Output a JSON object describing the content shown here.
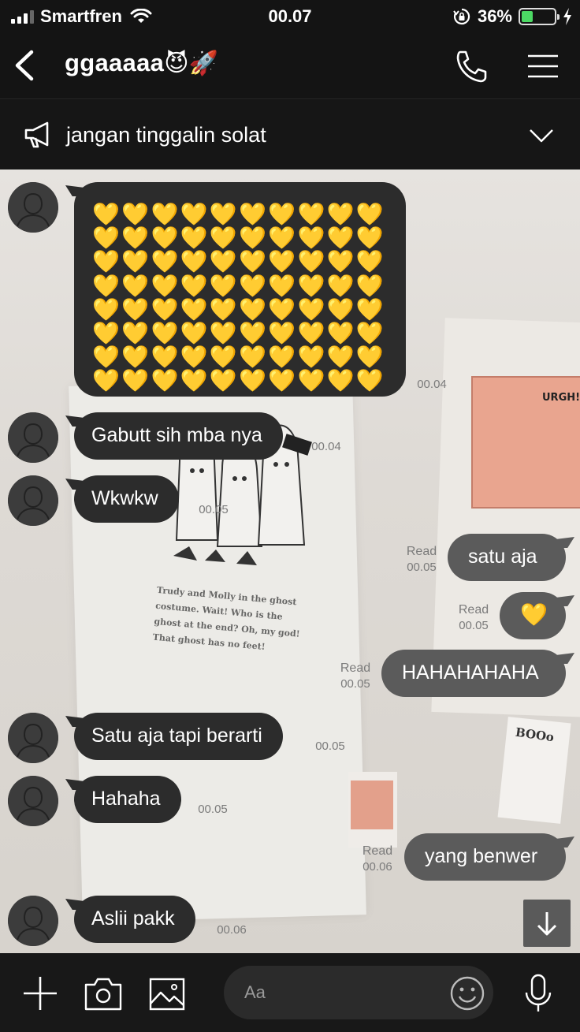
{
  "status_bar": {
    "carrier": "Smartfren",
    "time": "00.07",
    "battery_percent": "36%",
    "battery_level": 0.36
  },
  "header": {
    "title": "ggaaaaa",
    "title_emojis": "😈🚀"
  },
  "announcement": {
    "text": "jangan tinggalin solat"
  },
  "messages": [
    {
      "side": "in",
      "text": "💛💛💛💛💛💛💛💛💛💛💛💛💛💛💛💛💛💛💛💛💛💛💛💛💛💛💛💛💛💛💛💛💛💛💛💛💛💛💛💛💛💛💛💛💛💛💛💛💛💛💛💛💛💛💛💛💛💛💛💛💛💛💛💛💛💛💛💛💛💛💛💛💛💛💛💛💛💛💛💛",
      "time": "00.04"
    },
    {
      "side": "in",
      "text": "Gabutt sih mba nya",
      "time": "00.04"
    },
    {
      "side": "in",
      "text": "Wkwkw",
      "time": "00.05"
    },
    {
      "side": "out",
      "text": "satu aja",
      "read": "Read",
      "time": "00.05"
    },
    {
      "side": "out",
      "text": "💛",
      "read": "Read",
      "time": "00.05"
    },
    {
      "side": "out",
      "text": "HAHAHAHAHA",
      "read": "Read",
      "time": "00.05"
    },
    {
      "side": "in",
      "text": "Satu aja tapi berarti",
      "time": "00.05"
    },
    {
      "side": "in",
      "text": "Hahaha",
      "time": "00.05"
    },
    {
      "side": "out",
      "text": "yang benwer",
      "read": "Read",
      "time": "00.06"
    },
    {
      "side": "in",
      "text": "Aslii pakk",
      "time": "00.06"
    }
  ],
  "poster": {
    "caption": "Trudy and Molly in the ghost costume. Wait! Who is the ghost at the end? Oh, my god! That ghost has no feet!",
    "urgh": "URGH!!",
    "boo": "BOOo"
  },
  "input": {
    "placeholder": "Aa"
  },
  "icons": [
    "back-icon",
    "phone-icon",
    "menu-icon",
    "megaphone-icon",
    "chevron-down-icon",
    "scroll-down-icon",
    "plus-icon",
    "camera-icon",
    "image-icon",
    "emoji-icon",
    "microphone-icon"
  ]
}
